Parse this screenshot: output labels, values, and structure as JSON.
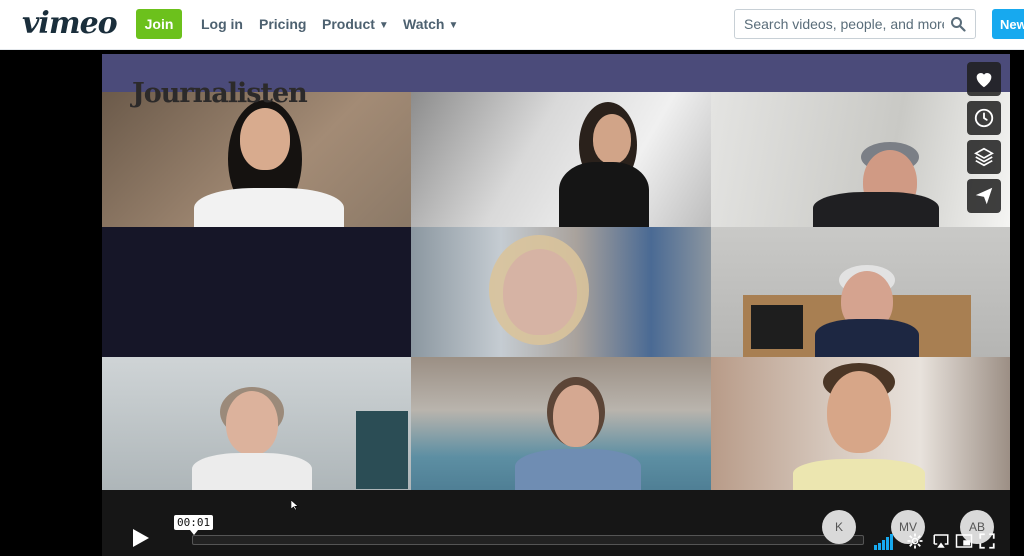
{
  "nav": {
    "logo": "vimeo",
    "join_label": "Join",
    "login_label": "Log in",
    "pricing_label": "Pricing",
    "product_label": "Product",
    "watch_label": "Watch",
    "search_placeholder": "Search videos, people, and more",
    "new_label": "New"
  },
  "video": {
    "title": "Journalisten",
    "time": "00:01",
    "progress": 0.0
  },
  "participants": [
    "K",
    "MV",
    "AB"
  ],
  "side_actions": [
    "heart-icon",
    "clock-icon",
    "layers-icon",
    "send-icon"
  ],
  "colors": {
    "join": "#6cc11c",
    "new": "#17a9ef",
    "volume": "#17a9ef",
    "banner": "#4b4b7a"
  }
}
